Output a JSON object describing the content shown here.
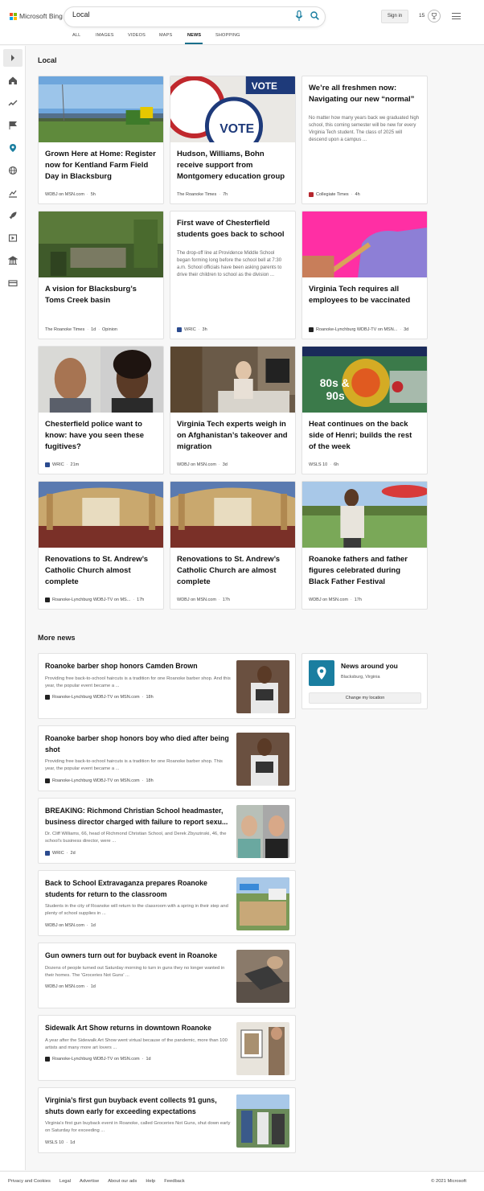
{
  "header": {
    "brand": "Microsoft Bing",
    "search_value": "Local",
    "signin_label": "Sign in",
    "rewards_count": "15"
  },
  "scopes": [
    "ALL",
    "IMAGES",
    "VIDEOS",
    "MAPS",
    "NEWS",
    "SHOPPING"
  ],
  "active_scope": "NEWS",
  "local_section": {
    "title": "Local",
    "cards": [
      {
        "title": "Grown Here at Home: Register now for Kentland Farm Field Day in Blacksburg",
        "snippet": "",
        "source": "WDBJ on MSN.com",
        "time": "5h",
        "tag": "",
        "thumb": "farm-field"
      },
      {
        "title": "Hudson, Williams, Bohn receive support from Montgomery education group",
        "snippet": "",
        "source": "The Roanoke Times",
        "time": "7h",
        "tag": "",
        "thumb": "vote-buttons"
      },
      {
        "title": "We’re all freshmen now: Navigating our new “normal”",
        "snippet": "No matter how many years back we graduated high school, this coming semester will be new for every Virginia Tech student. The class of 2025 will descend upon a campus ...",
        "source": "Collegiate Times",
        "time": "4h",
        "tag": "",
        "thumb": ""
      },
      {
        "title": "A vision for Blacksburg’s Toms Creek basin",
        "snippet": "",
        "source": "The Roanoke Times",
        "time": "1d",
        "tag": "Opinion",
        "thumb": "creek"
      },
      {
        "title": "First wave of Chesterfield students goes back to school",
        "snippet": "The drop-off line at Providence Middle School began forming long before the school bell at 7:30 a.m. School officials have been asking parents to drive their children to school as the division ...",
        "source": "WRIC",
        "time": "3h",
        "tag": "",
        "thumb": ""
      },
      {
        "title": "Virginia Tech requires all employees to be vaccinated",
        "snippet": "",
        "source": "Roanoke-Lynchburg WDBJ-TV on MSN...",
        "time": "3d",
        "tag": "",
        "thumb": "vaccine"
      },
      {
        "title": "Chesterfield police want to know: have you seen these fugitives?",
        "snippet": "",
        "source": "WRIC",
        "time": "21m",
        "tag": "",
        "thumb": "mugshots"
      },
      {
        "title": "Virginia Tech experts weigh in on Afghanistan’s takeover and migration",
        "snippet": "",
        "source": "WDBJ on MSN.com",
        "time": "3d",
        "tag": "",
        "thumb": "office"
      },
      {
        "title": "Heat continues on the back side of Henri; builds the rest of the week",
        "snippet": "",
        "source": "WSLS 10",
        "time": "6h",
        "tag": "",
        "thumb": "weather"
      },
      {
        "title": "Renovations to St. Andrew’s Catholic Church almost complete",
        "snippet": "",
        "source": "Roanoke-Lynchburg WDBJ-TV on MS...",
        "time": "17h",
        "tag": "",
        "thumb": "church"
      },
      {
        "title": "Renovations to St. Andrew’s Catholic Church are almost complete",
        "snippet": "",
        "source": "WDBJ on MSN.com",
        "time": "17h",
        "tag": "",
        "thumb": "church"
      },
      {
        "title": "Roanoke fathers and father figures celebrated during Black Father Festival",
        "snippet": "",
        "source": "WDBJ on MSN.com",
        "time": "17h",
        "tag": "",
        "thumb": "festival"
      }
    ]
  },
  "more_section": {
    "title": "More news",
    "items": [
      {
        "title": "Roanoke barber shop honors Camden Brown",
        "snippet": "Providing free back-to-school haircuts is a tradition for one Roanoke barber shop. And this year, the popular event became a ...",
        "source": "Roanoke-Lynchburg WDBJ-TV on MSN.com",
        "time": "18h"
      },
      {
        "title": "Roanoke barber shop honors boy who died after being shot",
        "snippet": "Providing free back-to-school haircuts is a tradition for one Roanoke barber shop. This year, the popular event became a ...",
        "source": "Roanoke-Lynchburg WDBJ-TV on MSN.com",
        "time": "18h"
      },
      {
        "title": "BREAKING: Richmond Christian School headmaster, business director charged with failure to report sexu...",
        "snippet": "Dr. Cliff Williams, 66, head of Richmond Christian School, and Derek Zbyszinski, 46, the school's business director, were ...",
        "source": "WRIC",
        "time": "2d"
      },
      {
        "title": "Back to School Extravaganza prepares Roanoke students for return to the classroom",
        "snippet": "Students in the city of Roanoke will return to the classroom with a spring in their step and plenty of school supplies in ...",
        "source": "WDBJ on MSN.com",
        "time": "1d"
      },
      {
        "title": "Gun owners turn out for buyback event in Roanoke",
        "snippet": "Dozens of people turned out Saturday morning to turn in guns they no longer wanted in their homes. The 'Groceries Not Guns' ...",
        "source": "WDBJ on MSN.com",
        "time": "1d"
      },
      {
        "title": "Sidewalk Art Show returns in downtown Roanoke",
        "snippet": "A year after the Sidewalk Art Show went virtual because of the pandemic, more than 100 artists and many more art lovers ...",
        "source": "Roanoke-Lynchburg WDBJ-TV on MSN.com",
        "time": "1d"
      },
      {
        "title": "Virginia’s first gun buyback event collects 91 guns, shuts down early for exceeding expectations",
        "snippet": "Virginia's first gun buyback event in Roanoke, called Groceries Not Guns, shut down early on Saturday for exceeding ...",
        "source": "WSLS 10",
        "time": "1d"
      }
    ]
  },
  "news_around": {
    "title": "News around you",
    "location": "Blacksburg, Virginia",
    "button_label": "Change my location"
  },
  "footer": {
    "links": [
      "Privacy and Cookies",
      "Legal",
      "Advertise",
      "About our ads",
      "Help",
      "Feedback"
    ],
    "copyright": "© 2021 Microsoft"
  }
}
